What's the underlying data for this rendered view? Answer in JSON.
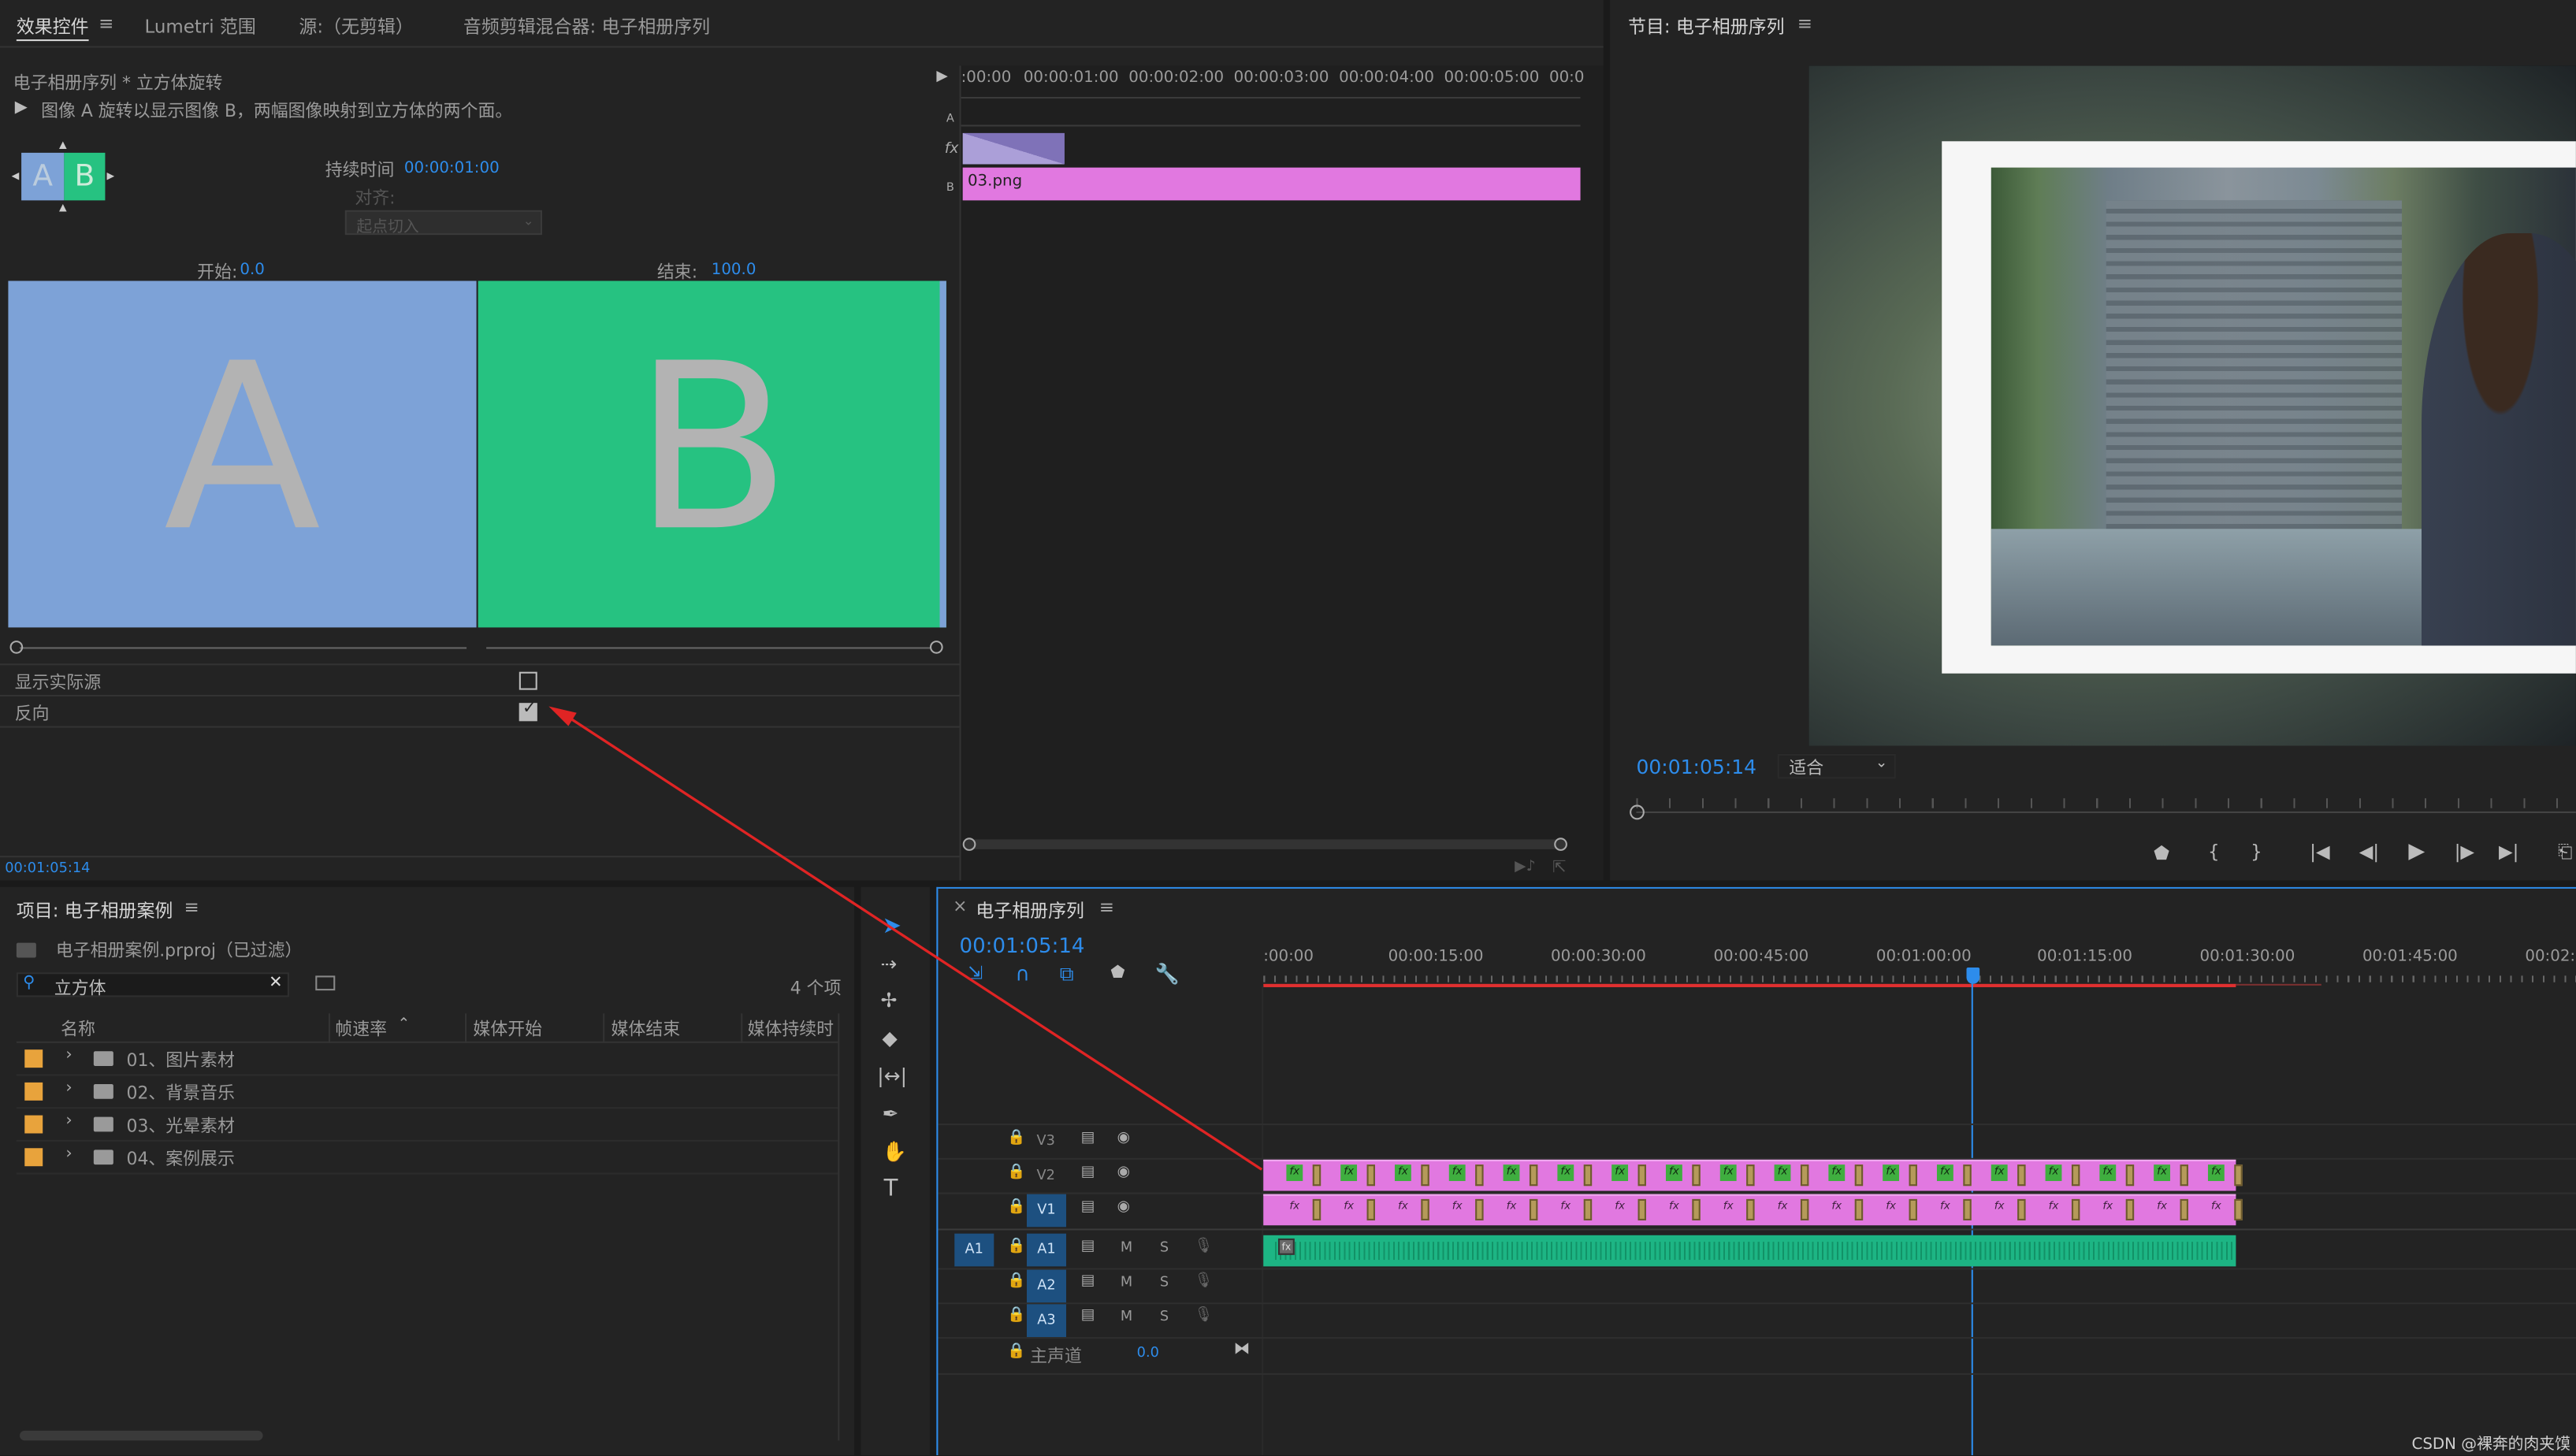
{
  "effect_controls": {
    "tabs": [
      "效果控件",
      "Lumetri 范围",
      "源:（无剪辑）",
      "音频剪辑混合器: 电子相册序列"
    ],
    "menu_glyph": "≡",
    "clip_path": "电子相册序列 * 立方体旋转",
    "description": "图像 A 旋转以显示图像 B，两幅图像映射到立方体的两个面。",
    "duration_label": "持续时间",
    "duration_value": "00:00:01:00",
    "align_label": "对齐:",
    "align_value": "起点切入",
    "start_label": "开始:",
    "start_value": "0.0",
    "end_label": "结束:",
    "end_value": "100.0",
    "letter_a": "A",
    "letter_b": "B",
    "show_actual_label": "显示实际源",
    "reverse_label": "反向",
    "show_actual_checked": false,
    "reverse_checked": true,
    "timecode": "00:01:05:14",
    "ruler_labels": [
      ":00:00",
      "00:00:01:00",
      "00:00:02:00",
      "00:00:03:00",
      "00:00:04:00",
      "00:00:05:00",
      "00:0"
    ],
    "track_a": "A",
    "track_fx": "fx",
    "track_b": "B",
    "clip_name": "03.png",
    "colors": {
      "a_face": "#7da2d7",
      "b_face": "#26c281",
      "clip_pink": "#e178e0"
    }
  },
  "program_monitor": {
    "title": "节目: 电子相册序列",
    "timecode": "00:01:05:14",
    "fit_value": "适合",
    "buttons": [
      "marker-icon",
      "mark-in-icon",
      "mark-out-icon",
      "go-to-in-icon",
      "step-back-icon",
      "play-icon",
      "step-forward-icon",
      "go-to-out-icon",
      "lift-icon"
    ]
  },
  "project": {
    "title": "项目: 电子相册案例",
    "file": "电子相册案例.prproj（已过滤）",
    "search_value": "立方体",
    "count": "4 个项",
    "columns": [
      "名称",
      "帧速率",
      "媒体开始",
      "媒体结束",
      "媒体持续时"
    ],
    "items": [
      "01、图片素材",
      "02、背景音乐",
      "03、光晕素材",
      "04、案例展示"
    ]
  },
  "timeline": {
    "title": "电子相册序列",
    "timecode": "00:01:05:14",
    "ruler_labels": [
      ":00:00",
      "00:00:15:00",
      "00:00:30:00",
      "00:00:45:00",
      "00:01:00:00",
      "00:01:15:00",
      "00:01:30:00",
      "00:01:45:00",
      "00:02:0"
    ],
    "video_tracks": [
      "V3",
      "V2",
      "V1"
    ],
    "audio_tracks": [
      "A1",
      "A2",
      "A3"
    ],
    "source_patch": "A1",
    "mute": "M",
    "solo": "S",
    "master_label": "主声道",
    "master_value": "0.0",
    "fx": "fx",
    "colors": {
      "video_clip": "#e178e0",
      "audio_clip": "#1db584",
      "playhead": "#2d8ceb",
      "work_area": "#e03030"
    }
  },
  "watermark": "CSDN @裸奔的肉夹馍"
}
